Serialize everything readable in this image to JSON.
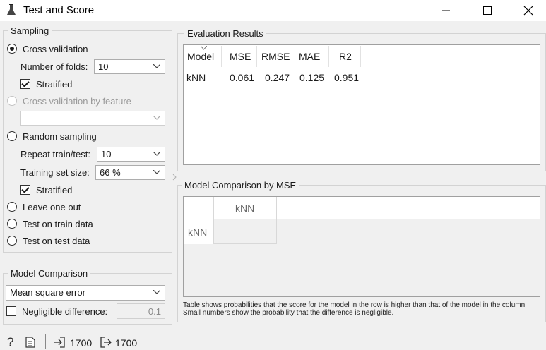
{
  "window": {
    "title": "Test and Score",
    "icons": [
      "flask-icon",
      "minimize-icon",
      "maximize-icon",
      "close-icon"
    ]
  },
  "sampling": {
    "group_label": "Sampling",
    "cross_validation": {
      "label": "Cross validation",
      "selected": true
    },
    "number_of_folds": {
      "label": "Number of folds:",
      "value": "10"
    },
    "cv_stratified": {
      "label": "Stratified",
      "checked": true
    },
    "cross_validation_by_feature": {
      "label": "Cross validation by feature",
      "enabled": false,
      "value": ""
    },
    "random_sampling": {
      "label": "Random sampling",
      "selected": false
    },
    "repeat_train_test": {
      "label": "Repeat train/test:",
      "value": "10"
    },
    "training_set_size": {
      "label": "Training set size:",
      "value": "66 %"
    },
    "rs_stratified": {
      "label": "Stratified",
      "checked": true
    },
    "leave_one_out": {
      "label": "Leave one out",
      "selected": false
    },
    "test_on_train": {
      "label": "Test on train data",
      "selected": false
    },
    "test_on_test": {
      "label": "Test on test data",
      "selected": false
    }
  },
  "model_comparison": {
    "group_label": "Model Comparison",
    "metric": "Mean square error",
    "negligible_label": "Negligible difference:",
    "negligible_checked": false,
    "negligible_value": "0.1"
  },
  "evaluation": {
    "group_label": "Evaluation Results",
    "columns": [
      "Model",
      "MSE",
      "RMSE",
      "MAE",
      "R2"
    ],
    "rows": [
      {
        "model": "kNN",
        "mse": "0.061",
        "rmse": "0.247",
        "mae": "0.125",
        "r2": "0.951"
      }
    ]
  },
  "comparison": {
    "group_label": "Model Comparison by MSE",
    "col_header": "kNN",
    "row_header": "kNN",
    "note_line1": "Table shows probabilities that the score for the model in the row is higher than that of the model in the column.",
    "note_line2": "Small numbers show the probability that the difference is negligible."
  },
  "status": {
    "input_count": "1700",
    "output_count": "1700",
    "icons": [
      "help-icon",
      "report-icon",
      "input-icon",
      "output-icon"
    ]
  }
}
